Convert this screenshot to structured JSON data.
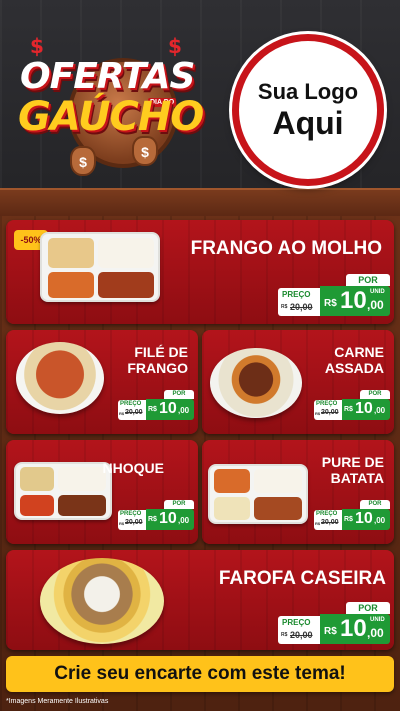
{
  "header": {
    "title_top": "OFERTAS",
    "title_small": "DIA DO",
    "title_bottom": "GAÚCHO"
  },
  "logo": {
    "line1": "Sua Logo",
    "line2": "Aqui"
  },
  "products": [
    {
      "name": "FRANGO AO MOLHO",
      "discount": "-50%",
      "por": "POR",
      "preco_label": "PREÇO",
      "old_currency": "R$",
      "old_price": "20,00",
      "currency": "R$",
      "price_int": "10",
      "price_cents": ",00",
      "unit": "UNID"
    },
    {
      "name_line1": "FILÉ DE",
      "name_line2": "FRANGO",
      "por": "POR",
      "preco_label": "PREÇO",
      "old_currency": "R$",
      "old_price": "20,00",
      "currency": "R$",
      "price_int": "10",
      "price_cents": ",00",
      "unit": "UNID"
    },
    {
      "name_line1": "CARNE",
      "name_line2": "ASSADA",
      "por": "POR",
      "preco_label": "PREÇO",
      "old_currency": "R$",
      "old_price": "20,00",
      "currency": "R$",
      "price_int": "10",
      "price_cents": ",00",
      "unit": "UNID"
    },
    {
      "name": "NHOQUE",
      "por": "POR",
      "preco_label": "PREÇO",
      "old_currency": "R$",
      "old_price": "20,00",
      "currency": "R$",
      "price_int": "10",
      "price_cents": ",00",
      "unit": "UNID"
    },
    {
      "name_line1": "PURE DE",
      "name_line2": "BATATA",
      "por": "POR",
      "preco_label": "PREÇO",
      "old_currency": "R$",
      "old_price": "20,00",
      "currency": "R$",
      "price_int": "10",
      "price_cents": ",00",
      "unit": "UNID"
    },
    {
      "name": "FAROFA CASEIRA",
      "por": "POR",
      "preco_label": "PREÇO",
      "old_currency": "R$",
      "old_price": "20,00",
      "currency": "R$",
      "price_int": "10",
      "price_cents": ",00",
      "unit": "UNID"
    }
  ],
  "cta": "Crie seu encarte com este tema!",
  "footnote": "*Imagens Meramente Ilustrativas",
  "colors": {
    "card_red": "#b3141b",
    "price_green": "#1f9a35",
    "accent_yellow": "#ffc21a",
    "logo_border": "#c7141a"
  }
}
